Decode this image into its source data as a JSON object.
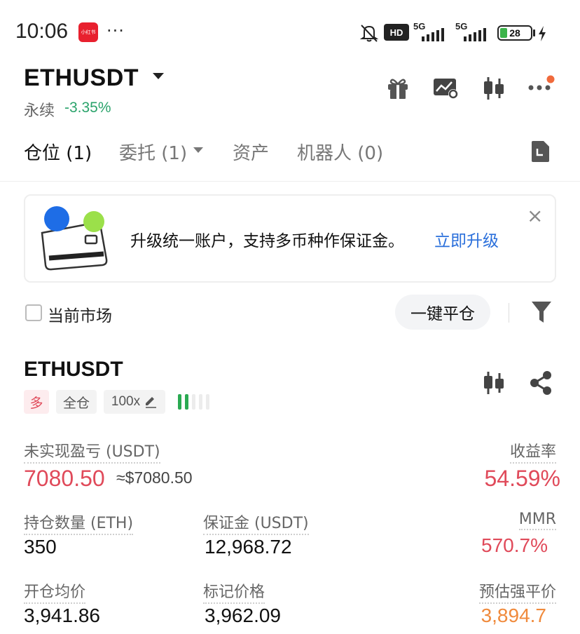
{
  "status_bar": {
    "time": "10:06",
    "app_badge": "小红书",
    "more": "···",
    "hd": "HD",
    "net1": "5G",
    "net2": "5G",
    "battery": "28"
  },
  "header": {
    "pair": "ETHUSDT",
    "type": "永续",
    "change": "-3.35%"
  },
  "tabs": [
    {
      "label": "仓位 (1)"
    },
    {
      "label": "委托 (1)"
    },
    {
      "label": "资产"
    },
    {
      "label": "机器人 (0)"
    }
  ],
  "banner": {
    "text": "升级统一账户，支持多币种作保证金。",
    "link": "立即升级",
    "close": "×"
  },
  "filter": {
    "current_market": "当前市场",
    "close_all": "一键平仓"
  },
  "position": {
    "pair": "ETHUSDT",
    "side": "多",
    "margin_mode": "全仓",
    "leverage": "100x",
    "unrealized_label": "未实现盈亏 (USDT)",
    "unrealized_value": "7080.50",
    "unrealized_usd": "≈$7080.50",
    "roe_label": "收益率",
    "roe_value": "54.59%",
    "qty_label": "持仓数量 (ETH)",
    "qty_value": "350",
    "margin_label": "保证金 (USDT)",
    "margin_value": "12,968.72",
    "mmr_label": "MMR",
    "mmr_value": "570.7%",
    "entry_label": "开仓均价",
    "entry_value": "3,941.86",
    "mark_label": "标记价格",
    "mark_value": "3,962.09",
    "liq_label": "预估强平价",
    "liq_value": "3,894.7"
  },
  "colors": {
    "red": "#e04a5a",
    "green": "#2aa36b",
    "blue_link": "#2a6fdb",
    "orange": "#f08a3c"
  }
}
